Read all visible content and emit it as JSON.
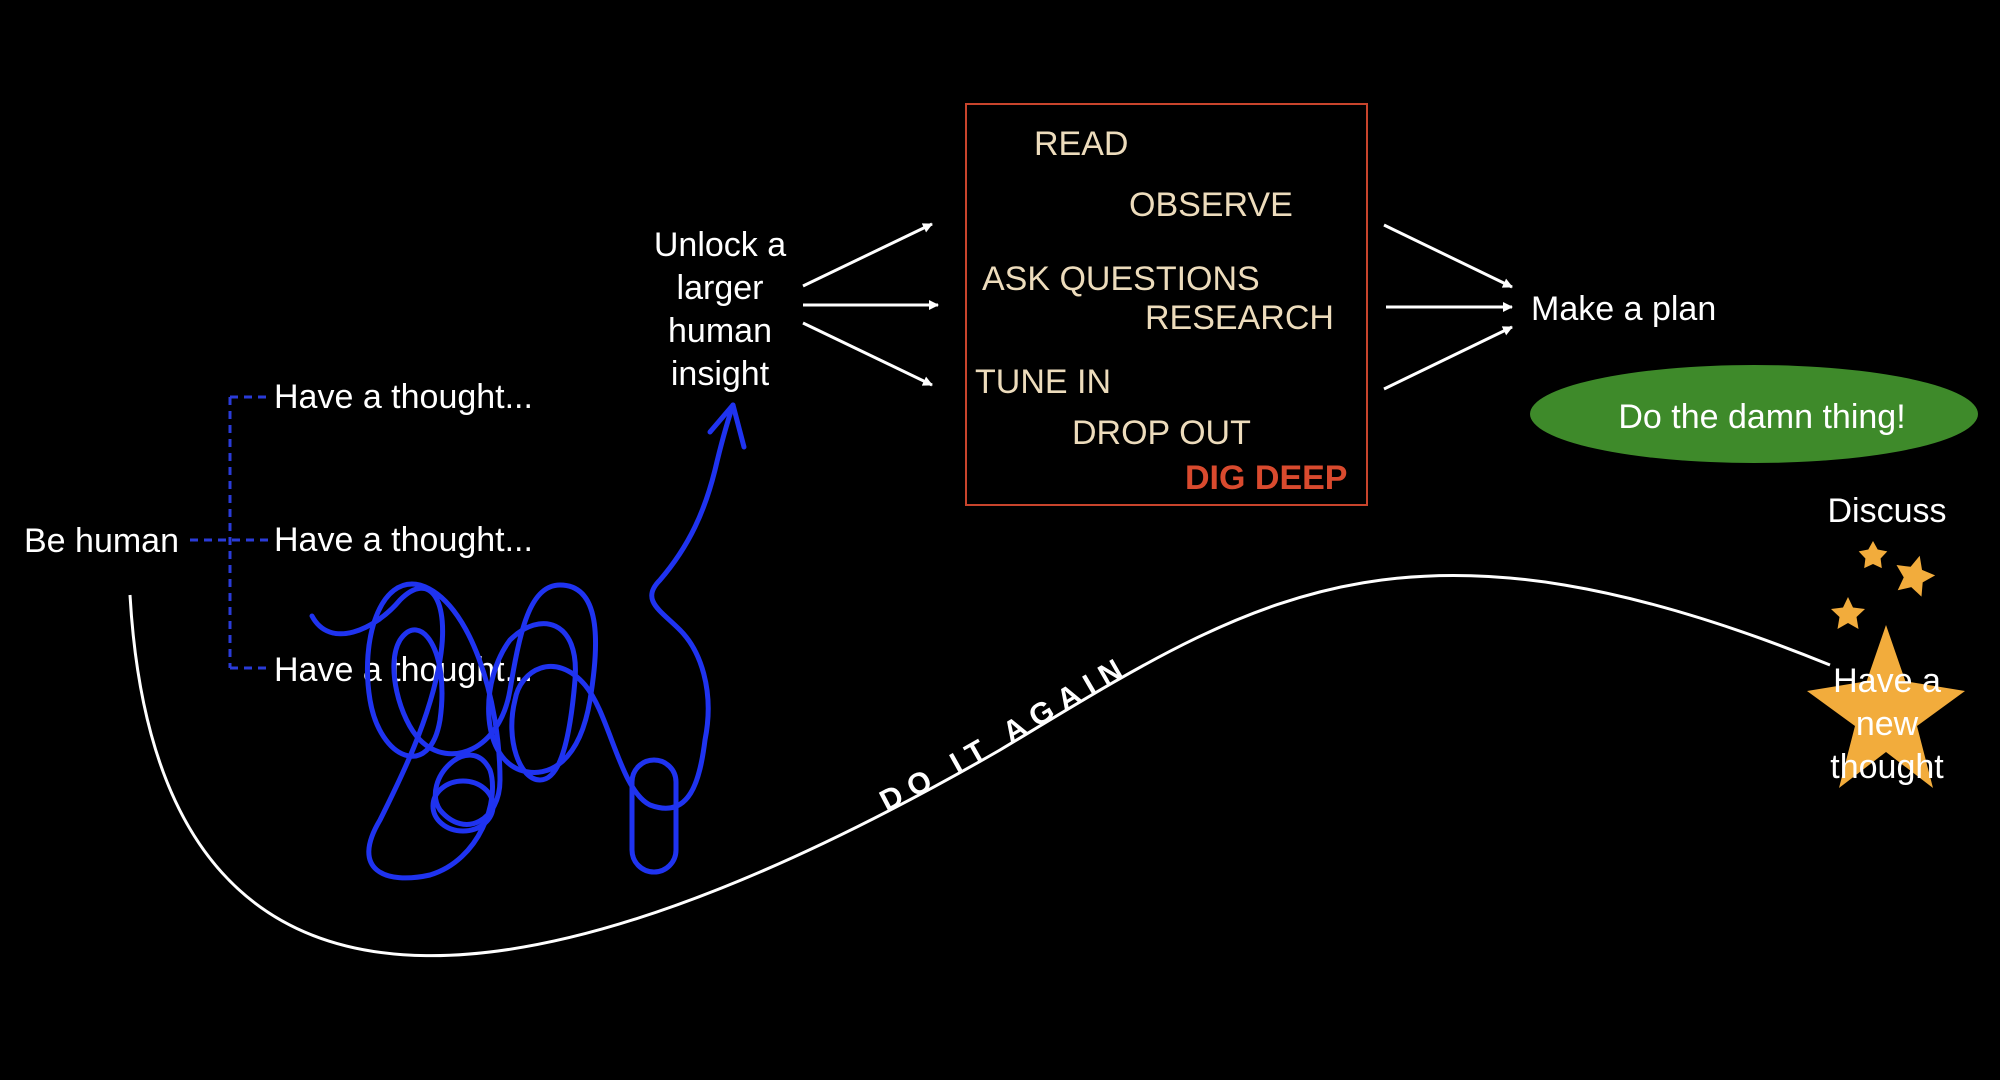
{
  "left": {
    "be_human": "Be human",
    "thoughts": [
      "Have a thought...",
      "Have a thought...",
      "Have a thought..."
    ]
  },
  "insight": {
    "lines": [
      "Unlock a",
      "larger",
      "human",
      "insight"
    ]
  },
  "box": {
    "items": [
      "READ",
      "OBSERVE",
      "ASK QUESTIONS",
      "RESEARCH",
      "TUNE IN",
      "DROP OUT"
    ],
    "emphasis": "DIG DEEP"
  },
  "right": {
    "plan": "Make a plan",
    "action": "Do the damn thing!",
    "discuss": "Discuss",
    "new_thought": [
      "Have a",
      "new",
      "thought"
    ]
  },
  "curve_label": "DO IT AGAIN",
  "colors": {
    "background": "#000000",
    "text": "#ffffff",
    "box_text": "#eddcbc",
    "box_border": "#c8442c",
    "emphasis": "#d94a2e",
    "scribble": "#1f33f0",
    "connector": "#2a3bd8",
    "pill": "#3e8a2a",
    "star": "#f2ac3c"
  }
}
